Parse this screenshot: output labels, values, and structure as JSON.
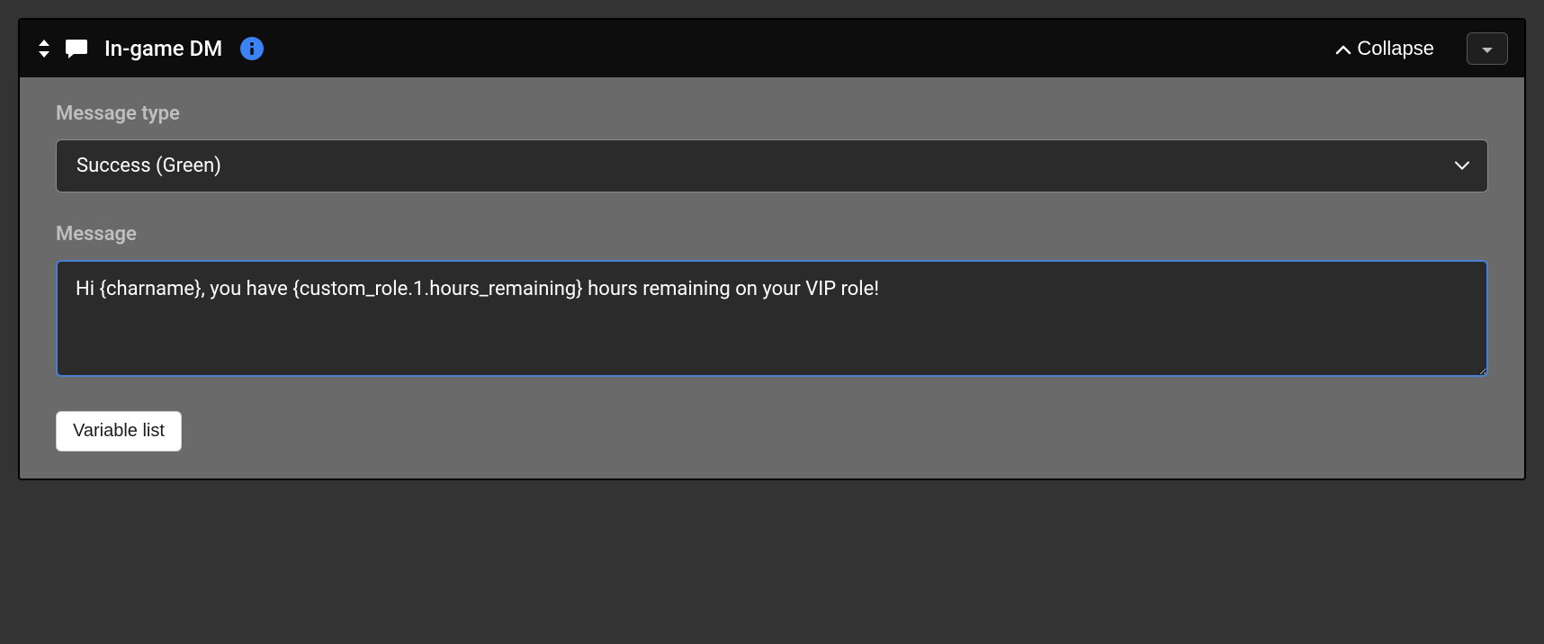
{
  "header": {
    "title": "In-game DM",
    "collapse_label": "Collapse"
  },
  "form": {
    "message_type_label": "Message type",
    "message_type_value": "Success (Green)",
    "message_label": "Message",
    "message_value": "Hi {charname}, you have {custom_role.1.hours_remaining} hours remaining on your VIP role!",
    "variable_list_label": "Variable list"
  },
  "icons": {
    "drag": "drag-handle-icon",
    "chat": "chat-bubble-icon",
    "info": "info-icon",
    "chevron_up": "chevron-up-icon",
    "caret_down": "caret-down-icon",
    "select_chevron": "chevron-down-icon"
  }
}
